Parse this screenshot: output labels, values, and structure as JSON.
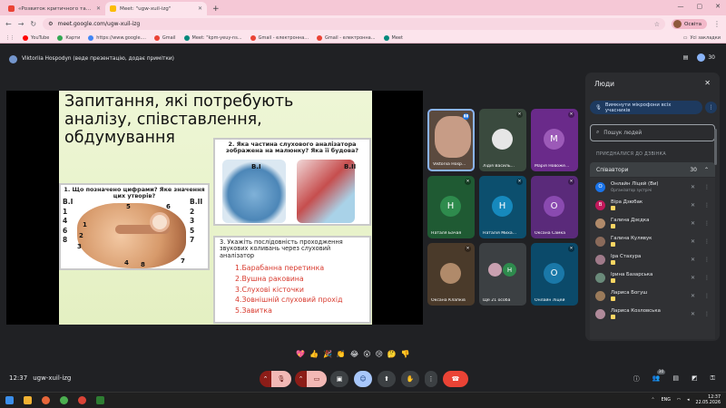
{
  "browser": {
    "tabs": [
      {
        "title": "«Розвиток критичного та про",
        "active": false,
        "favicon_color": "#ea4335"
      },
      {
        "title": "Meet: \"ugw-xuil-izg\"",
        "active": true,
        "favicon_color": "#fbbc04"
      }
    ],
    "new_tab": "+",
    "url": "meet.google.com/ugw-xuil-izg",
    "profile_label": "Освіта",
    "bookmarks": [
      {
        "label": "YouTube",
        "color": "#ff0000"
      },
      {
        "label": "Карти",
        "color": "#34a853"
      },
      {
        "label": "https://www.google....",
        "color": "#4285f4"
      },
      {
        "label": "Gmail",
        "color": "#ea4335"
      },
      {
        "label": "Meet: \"kpm-yeuy-ns...",
        "color": "#00897b"
      },
      {
        "label": "Gmail - електронна...",
        "color": "#ea4335"
      },
      {
        "label": "Gmail - електронна...",
        "color": "#ea4335"
      },
      {
        "label": "Meet",
        "color": "#00897b"
      }
    ],
    "bookmarks_right": "Усі закладки"
  },
  "meet": {
    "presenter_text": "Viktoriia Hospodyn (веде презентацію, додає примітки)",
    "participant_count": "30",
    "slide": {
      "title": "Запитання, які потребують аналізу, співставлення, обдумування",
      "q1": "1. Що позначено цифрами? Яке значення цих утворів?",
      "q1_col1_head": "В.I",
      "q1_col1": [
        "1",
        "4",
        "6",
        "8"
      ],
      "q1_col2_head": "В.II",
      "q1_col2": [
        "2",
        "3",
        "5",
        "7"
      ],
      "figure_numbers": [
        "1",
        "2",
        "3",
        "4",
        "5",
        "6",
        "7",
        "8"
      ],
      "q2": "2. Яка частина слухового аналізатора зображена на малюнку? Яка її будова?",
      "q2_v1": "В.I",
      "q2_v2": "В.II",
      "q3": "3. Укажіть послідовність проходження звукових коливань через слуховий аналізатор",
      "q3_items": [
        "1.Барабанна перетинка",
        "2.Вушна раковина",
        "3.Слухові кісточки",
        "4.Зовнішній слуховий прохід",
        "5.Завитка"
      ]
    },
    "tiles": [
      {
        "name": "Viktoriia Hosp...",
        "initial": "",
        "bg": "#5b4a3f",
        "circle": "#c79c86"
      },
      {
        "name": "Лідія Василь...",
        "initial": "",
        "bg": "#3a4a3e",
        "circle": "#e6e6e6"
      },
      {
        "name": "Марія Новоже...",
        "initial": "M",
        "bg": "#6a2a8a",
        "circle": "#9c5ab8"
      },
      {
        "name": "Наталя Бачая",
        "initial": "Н",
        "bg": "#1f5a33",
        "circle": "#2e8b4d"
      },
      {
        "name": "Наталія Миха...",
        "initial": "Н",
        "bg": "#0c4f6e",
        "circle": "#1689bd"
      },
      {
        "name": "Оксана Самка",
        "initial": "О",
        "bg": "#5a2a7a",
        "circle": "#8a4ab0"
      },
      {
        "name": "Оксана Клапків",
        "initial": "",
        "bg": "#4a3a2a",
        "circle": "#b08a6a"
      },
      {
        "name": "Ще 21 особа",
        "initial": "Н",
        "bg": "#3c4043",
        "circle": "#2e8b4d"
      },
      {
        "name": "Онлайн Ліцей",
        "initial": "О",
        "bg": "#0b4a6a",
        "circle": "#1a78a8"
      }
    ],
    "reactions": [
      "💖",
      "👍",
      "🎉",
      "👏",
      "😂",
      "😮",
      "😢",
      "🤔",
      "👎"
    ],
    "time": "12:37",
    "meeting_code": "ugw-xuil-izg",
    "chat_badge": "30"
  },
  "panel": {
    "title": "Люди",
    "mute_all": "Вимкнути мікрофони всіх учасників",
    "search_placeholder": "Пошук людей",
    "section": "ПРИЄДНАЛИСЯ ДО ДЗВІНКА",
    "group_label": "Співавтори",
    "group_count": "30",
    "people": [
      {
        "name": "Онлайн Ліцей (Ви)",
        "sub": "Організатор зустрічі",
        "initial": "О",
        "color": "#1a73e8",
        "hand": false
      },
      {
        "name": "Віра Дзюбак",
        "sub": "",
        "initial": "В",
        "color": "#c2185b",
        "hand": true
      },
      {
        "name": "Галина Дзєдка",
        "sub": "",
        "initial": "",
        "color": "#b08a6a",
        "hand": true
      },
      {
        "name": "Галина Кулявук",
        "sub": "",
        "initial": "",
        "color": "#8a6a5a",
        "hand": true
      },
      {
        "name": "Іра Стахура",
        "sub": "",
        "initial": "",
        "color": "#a07a8a",
        "hand": true
      },
      {
        "name": "Ірина Базарська",
        "sub": "",
        "initial": "",
        "color": "#6a8a7a",
        "hand": true
      },
      {
        "name": "Лариса Богуш",
        "sub": "",
        "initial": "",
        "color": "#9a7a5a",
        "hand": true
      },
      {
        "name": "Лариса Козловська",
        "sub": "",
        "initial": "",
        "color": "#b08a9a",
        "hand": true
      }
    ]
  },
  "taskbar": {
    "lang": "ENG",
    "time": "12:37",
    "date": "22.05.2026"
  }
}
